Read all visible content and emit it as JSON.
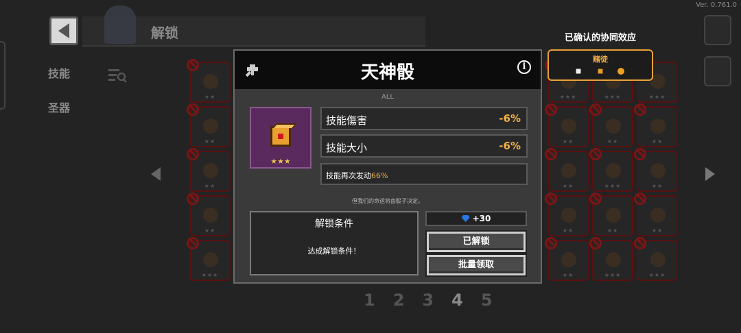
{
  "version": "Ver. 0.761.0",
  "header": {
    "title": "解锁"
  },
  "left_tabs": [
    {
      "label": "技能"
    },
    {
      "label": "圣器"
    }
  ],
  "pagination": {
    "pages": [
      "1",
      "2",
      "3",
      "4",
      "5"
    ],
    "current": "4"
  },
  "grid_cells": [
    {
      "stars": "★★"
    },
    {
      "stars": "★★"
    },
    {
      "stars": "★★"
    },
    {
      "stars": "★★"
    },
    {
      "stars": "★★★"
    },
    {
      "stars": "★★"
    },
    {
      "stars": "★★"
    },
    {
      "stars": "★★"
    },
    {
      "stars": "★★"
    },
    {
      "stars": "★★★"
    },
    {
      "stars": "★★"
    },
    {
      "stars": "★★"
    },
    {
      "stars": "★★"
    },
    {
      "stars": "★★"
    },
    {
      "stars": "★★"
    },
    {
      "stars": "★★★"
    },
    {
      "stars": "★★★"
    },
    {
      "stars": "★★★"
    },
    {
      "stars": "★★★"
    },
    {
      "stars": "★★★"
    }
  ],
  "synergy": {
    "heading": "已确认的协同效应",
    "name": "赌徒",
    "accent_color": "#e8a238"
  },
  "modal": {
    "title": "天神骰",
    "category": "ALL",
    "rarity_stars": "★★★",
    "stats": [
      {
        "label": "技能傷害",
        "value": "-6%"
      },
      {
        "label": "技能大小",
        "value": "-6%"
      }
    ],
    "effect": {
      "text": "技能再次发动",
      "highlight": "66%"
    },
    "flavor_text": "但我们的命运将由骰子决定。",
    "unlock_condition": {
      "title": "解锁条件",
      "description": "达成解锁条件！"
    },
    "reward": {
      "icon": "gem-icon",
      "amount": "+30"
    },
    "buttons": {
      "unlocked": "已解锁",
      "bulk_claim": "批量领取"
    }
  },
  "colors": {
    "highlight": "#f2b14a",
    "modal_bg": "#3a3a3a",
    "portrait_bg": "#5a2a5e"
  }
}
